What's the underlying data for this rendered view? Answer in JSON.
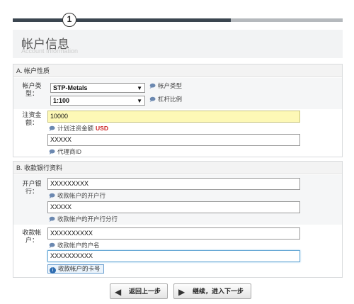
{
  "progress": {
    "step": "1",
    "completed_fraction": 0.66
  },
  "header": {
    "title": "帐户信息",
    "subtitle": "Account Information"
  },
  "section_a": {
    "title": "A. 帐户性质",
    "account_type": {
      "label_line1": "帐户类",
      "label_line2": "型：",
      "value": "STP-Metals",
      "hint": "帐户类型",
      "hint_icon": "comment-icon"
    },
    "leverage": {
      "value": "1:100",
      "hint": "杠杆比例",
      "hint_icon": "comment-icon"
    },
    "deposit": {
      "label_line1": "注资金",
      "label_line2": "额：",
      "value": "10000",
      "hint": "计划注资金额",
      "currency": "USD",
      "hint_icon": "comment-icon"
    },
    "agent": {
      "value": "XXXXX",
      "hint": "代理商ID",
      "hint_icon": "comment-icon"
    }
  },
  "section_b": {
    "title": "B. 收款银行资料",
    "bank": {
      "label_line1": "开户银",
      "label_line2": "行：",
      "value": "XXXXXXXXX",
      "hint": "收款帐户的开户行"
    },
    "branch": {
      "value": "XXXXX",
      "hint": "收款帐户的开户行分行"
    },
    "account": {
      "label_line1": "收款帐",
      "label_line2": "户：",
      "value": "XXXXXXXXXX",
      "hint": "收款帐户的户名"
    },
    "card": {
      "value": "XXXXXXXXXX",
      "tip": "收款帐户的卡号"
    }
  },
  "buttons": {
    "back_label": "返回上一步",
    "next_label": "继续，进入下一步"
  }
}
